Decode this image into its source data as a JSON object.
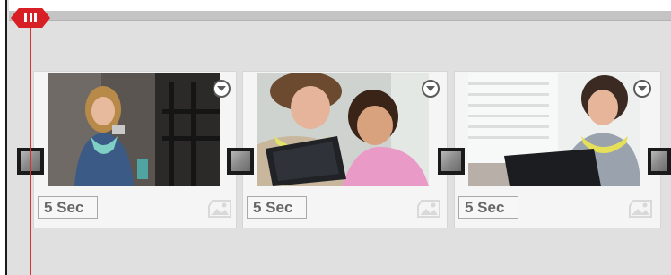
{
  "timeline": {
    "clips": [
      {
        "duration_label": "5 Sec",
        "thumbnail": "woman-with-phone"
      },
      {
        "duration_label": "5 Sec",
        "thumbnail": "mother-daughter-tablet"
      },
      {
        "duration_label": "5 Sec",
        "thumbnail": "woman-with-tablet"
      }
    ]
  },
  "icons": {
    "clip_menu": "chevron-down-circle-icon",
    "clip_type": "image-icon",
    "transition_handle": "transition-handle-icon",
    "playhead": "playhead-icon"
  },
  "colors": {
    "playhead": "#d81f26",
    "timeline_bg": "#e0e0e0",
    "clip_bg": "#f5f5f5",
    "label_text": "#666666"
  }
}
